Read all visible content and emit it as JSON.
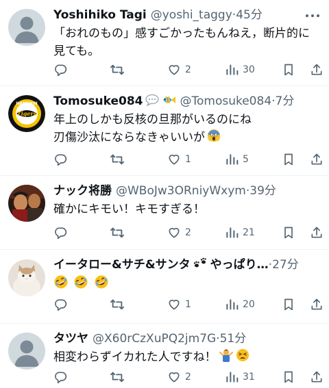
{
  "posts": [
    {
      "display_name": "Yoshihiko Tagi",
      "handle": "@yoshi_taggy",
      "separator": "·",
      "time": "45分",
      "text_lines": [
        "「おれのもの」感すごかったもんねえ，断片的に",
        "見ても。"
      ],
      "counts": {
        "replies": "",
        "reposts": "",
        "likes": "2",
        "views": "30"
      },
      "avatar": "default-avatar"
    },
    {
      "display_name": "Tomosuke084",
      "name_emojis": [
        "speech-bubble",
        "tropical-fish"
      ],
      "handle": "@Tomosuke084",
      "separator": "·",
      "time": "7分",
      "text_lines": [
        "年上のしかも反核の旦那がいるのにね",
        "刃傷沙汰にならなきゃいいが"
      ],
      "text_emoji": "screaming-face",
      "counts": {
        "replies": "",
        "reposts": "",
        "likes": "1",
        "views": "5"
      },
      "avatar": "hanshin-tigers-logo",
      "avatar_text_top": "HANSHIN",
      "avatar_text_bottom": "Tigers"
    },
    {
      "display_name": "ナック将勝",
      "handle": "@WBoJw3ORniyWxym",
      "separator": "·",
      "time": "39分",
      "text_lines": [
        "確かにキモい！キモすぎる！"
      ],
      "counts": {
        "replies": "",
        "reposts": "",
        "likes": "2",
        "views": "21"
      },
      "avatar": "photo-avatar"
    },
    {
      "display_name": "イータロー&サチ&サンタ",
      "name_emojis": [
        "paw-prints"
      ],
      "name_suffix": "やっぱり…",
      "handle": "",
      "separator": "·",
      "time": "27分",
      "text_lines": [
        ""
      ],
      "text_emojis": [
        "rolling-laughing-face",
        "rolling-laughing-face",
        "rolling-laughing-face"
      ],
      "counts": {
        "replies": "",
        "reposts": "",
        "likes": "1",
        "views": "20"
      },
      "avatar": "cat-photo-avatar"
    },
    {
      "display_name": "タツヤ",
      "handle": "@X60rCzXuPQ2jm7G",
      "separator": "·",
      "time": "51分",
      "text_lines": [
        "相変わらずイカれた人ですね！"
      ],
      "text_emojis": [
        "person-shrugging",
        "weary-face"
      ],
      "counts": {
        "replies": "",
        "reposts": "",
        "likes": "2",
        "views": "31"
      },
      "avatar": "default-avatar"
    }
  ],
  "colors": {
    "text": "#0f1419",
    "secondary": "#536471",
    "divider": "#eff3f4",
    "avatar_bg": "#cfd9de"
  }
}
